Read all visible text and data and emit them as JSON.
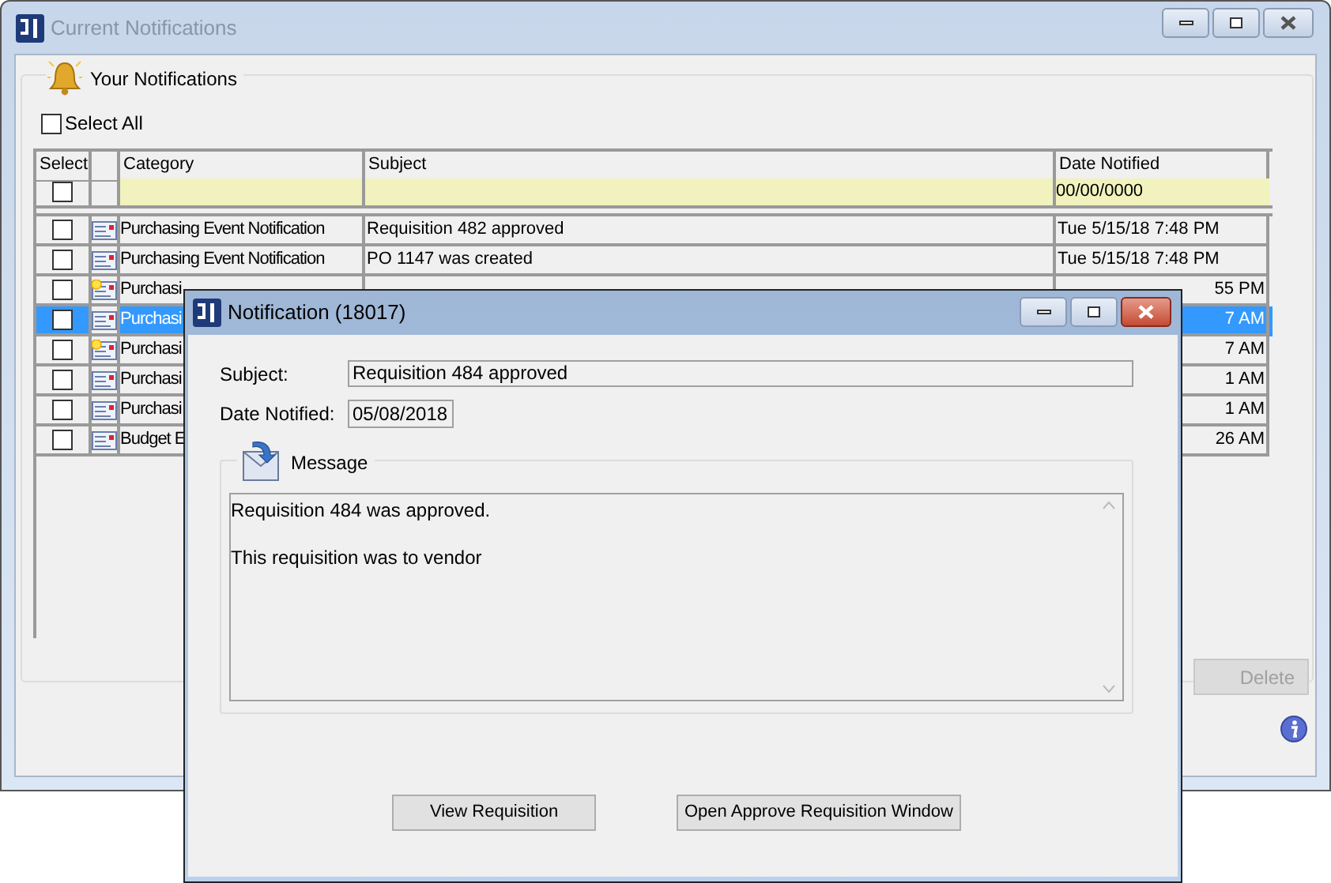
{
  "main_window": {
    "title": "Current Notifications",
    "group_title": "Your Notifications",
    "select_all": {
      "label": "Select All",
      "checked": false
    },
    "columns": [
      "Select",
      "Category",
      "Subject",
      "Date Notified"
    ],
    "filter": {
      "checked": false,
      "date": "00/00/0000"
    },
    "rows": [
      {
        "checked": false,
        "new": false,
        "selected": false,
        "category": "Purchasing Event Notification",
        "subject": "Requisition 482 approved",
        "date": "Tue 5/15/18 7:48 PM"
      },
      {
        "checked": false,
        "new": false,
        "selected": false,
        "category": "Purchasing Event Notification",
        "subject": "PO 1147 was created",
        "date": "Tue 5/15/18 7:48 PM"
      },
      {
        "checked": false,
        "new": true,
        "selected": false,
        "category": "Purchasi",
        "date": "55 PM"
      },
      {
        "checked": false,
        "new": false,
        "selected": true,
        "category": "Purchasi",
        "date": "7 AM"
      },
      {
        "checked": false,
        "new": true,
        "selected": false,
        "category": "Purchasi",
        "date": "7 AM"
      },
      {
        "checked": false,
        "new": false,
        "selected": false,
        "category": "Purchasi",
        "date": "1 AM"
      },
      {
        "checked": false,
        "new": false,
        "selected": false,
        "category": "Purchasi",
        "date": "1 AM"
      },
      {
        "checked": false,
        "new": false,
        "selected": false,
        "category": "Budget E",
        "date": "26 AM"
      }
    ],
    "delete_button": {
      "label": "Delete",
      "disabled": true
    }
  },
  "dialog": {
    "title": "Notification (18017)",
    "subject_label": "Subject:",
    "subject": "Requisition 484 approved",
    "date_label": "Date Notified:",
    "date": "05/08/2018",
    "message_title": "Message",
    "message_lines": [
      "Requisition 484 was approved.",
      "This requisition was to vendor"
    ],
    "buttons": [
      "View Requisition",
      "Open Approve Requisition Window"
    ]
  }
}
